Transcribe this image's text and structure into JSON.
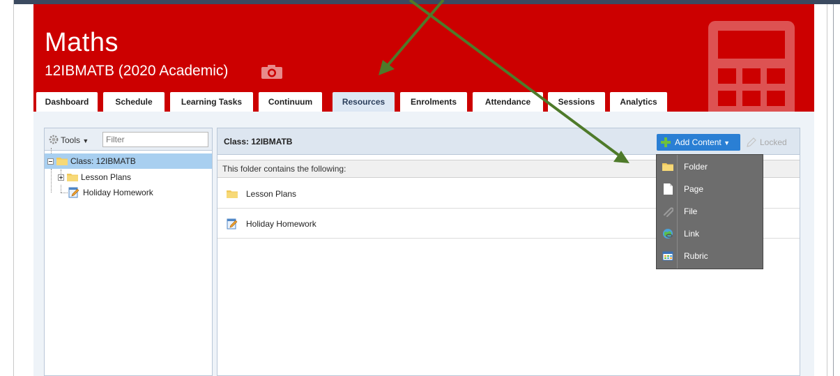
{
  "header": {
    "title": "Maths",
    "subtitle": "12IBMATB (2020 Academic)",
    "brand_color": "#cc0000"
  },
  "tabs": [
    {
      "label": "Dashboard",
      "active": false
    },
    {
      "label": "Schedule",
      "active": false
    },
    {
      "label": "Learning Tasks",
      "active": false
    },
    {
      "label": "Continuum",
      "active": false
    },
    {
      "label": "Resources",
      "active": true
    },
    {
      "label": "Enrolments",
      "active": false
    },
    {
      "label": "Attendance",
      "active": false
    },
    {
      "label": "Sessions",
      "active": false
    },
    {
      "label": "Analytics",
      "active": false
    }
  ],
  "sidebar": {
    "tools_label": "Tools",
    "filter_placeholder": "Filter",
    "tree": [
      {
        "label": "Class: 12IBMATB",
        "selected": true,
        "icon": "folder-icon"
      },
      {
        "label": "Lesson Plans",
        "selected": false,
        "icon": "folder-icon"
      },
      {
        "label": "Holiday Homework",
        "selected": false,
        "icon": "page-edit-icon"
      }
    ]
  },
  "main": {
    "class_label": "Class: 12IBMATB",
    "add_content_label": "Add Content",
    "locked_label": "Locked",
    "list_header": "This folder contains the following:",
    "items": [
      {
        "label": "Lesson Plans",
        "icon": "folder-icon"
      },
      {
        "label": "Holiday Homework",
        "icon": "page-edit-icon"
      }
    ]
  },
  "add_menu": {
    "items": [
      {
        "label": "Folder",
        "icon": "folder-icon"
      },
      {
        "label": "Page",
        "icon": "page-icon"
      },
      {
        "label": "File",
        "icon": "paperclip-icon"
      },
      {
        "label": "Link",
        "icon": "globe-link-icon"
      },
      {
        "label": "Rubric",
        "icon": "grid-icon"
      }
    ]
  },
  "annotation_color": "#4e7a2a"
}
